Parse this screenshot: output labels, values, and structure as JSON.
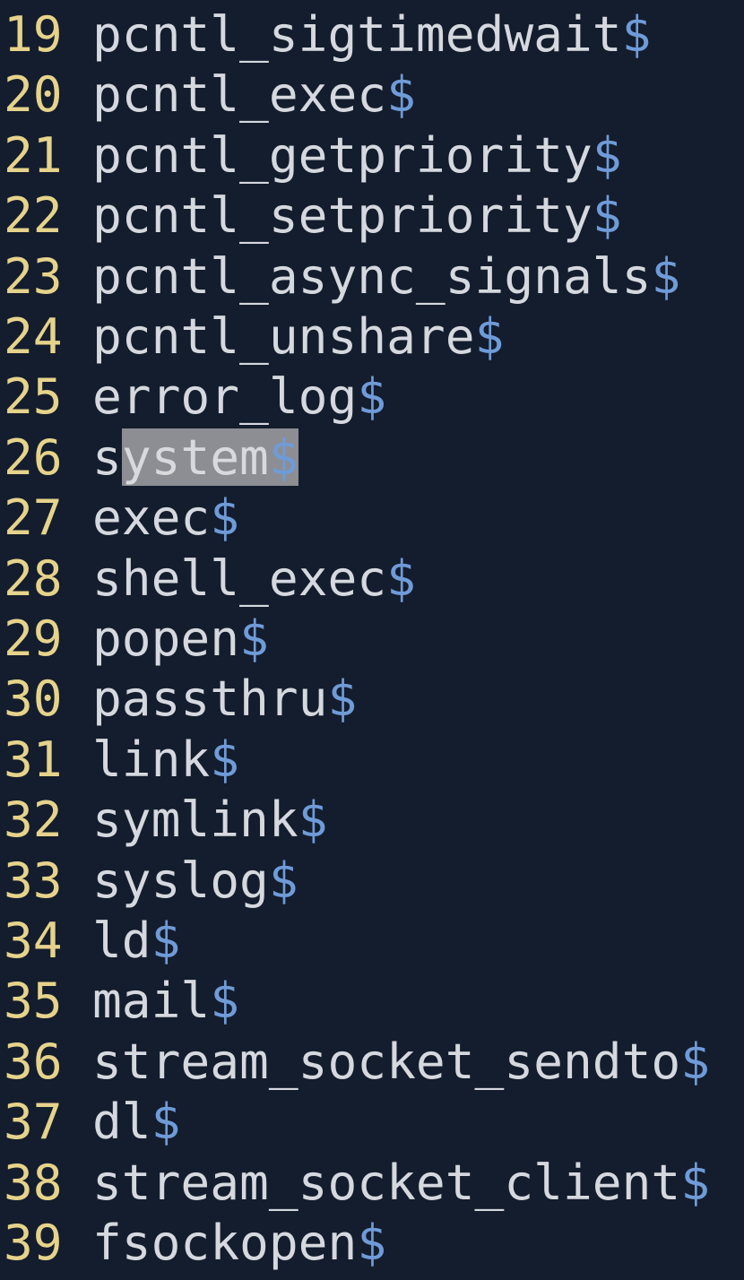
{
  "editor": {
    "eol_marker": "$",
    "selection": {
      "line_index": 7,
      "before": "s",
      "selected": "ystem"
    },
    "lines": [
      {
        "number": "19",
        "text": "pcntl_sigtimedwait"
      },
      {
        "number": "20",
        "text": "pcntl_exec"
      },
      {
        "number": "21",
        "text": "pcntl_getpriority"
      },
      {
        "number": "22",
        "text": "pcntl_setpriority"
      },
      {
        "number": "23",
        "text": "pcntl_async_signals"
      },
      {
        "number": "24",
        "text": "pcntl_unshare"
      },
      {
        "number": "25",
        "text": "error_log"
      },
      {
        "number": "26",
        "text": "system"
      },
      {
        "number": "27",
        "text": "exec"
      },
      {
        "number": "28",
        "text": "shell_exec"
      },
      {
        "number": "29",
        "text": "popen"
      },
      {
        "number": "30",
        "text": "passthru"
      },
      {
        "number": "31",
        "text": "link"
      },
      {
        "number": "32",
        "text": "symlink"
      },
      {
        "number": "33",
        "text": "syslog"
      },
      {
        "number": "34",
        "text": "ld"
      },
      {
        "number": "35",
        "text": "mail"
      },
      {
        "number": "36",
        "text": "stream_socket_sendto"
      },
      {
        "number": "37",
        "text": "dl"
      },
      {
        "number": "38",
        "text": "stream_socket_client"
      },
      {
        "number": "39",
        "text": "fsockopen"
      }
    ]
  }
}
